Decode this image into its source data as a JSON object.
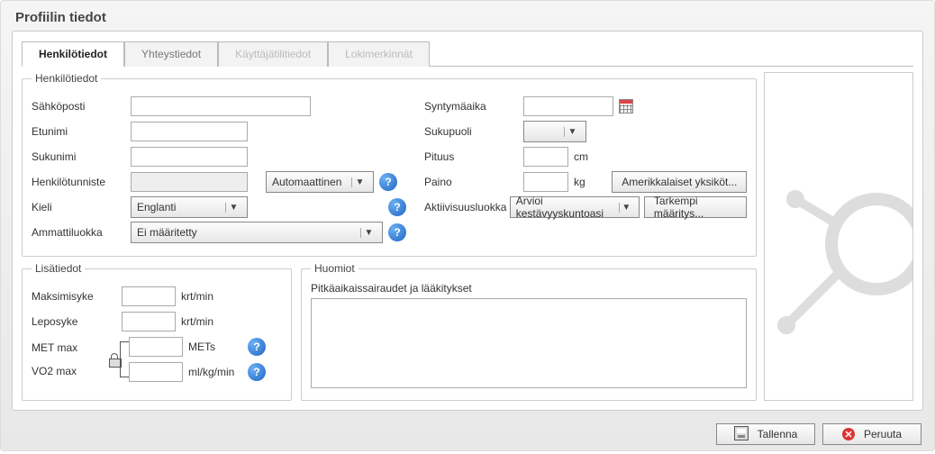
{
  "title": "Profiilin tiedot",
  "tabs": {
    "personal": "Henkilötiedot",
    "contact": "Yhteystiedot",
    "account": "Käyttäjätilitiedot",
    "log": "Lokimerkinnät"
  },
  "groups": {
    "personal": "Henkilötiedot",
    "additional": "Lisätiedot",
    "notes": "Huomiot"
  },
  "labels": {
    "email": "Sähköposti",
    "firstname": "Etunimi",
    "lastname": "Sukunimi",
    "personId": "Henkilötunniste",
    "language": "Kieli",
    "profession": "Ammattiluokka",
    "birthdate": "Syntymäaika",
    "gender": "Sukupuoli",
    "height": "Pituus",
    "weight": "Paino",
    "activity": "Aktiivisuusluokka",
    "hrmax": "Maksimisyke",
    "hrrest": "Leposyke",
    "metmax": "MET max",
    "vo2max": "VO2 max",
    "notesDesc": "Pitkäaikaissairaudet ja lääkitykset"
  },
  "units": {
    "cm": "cm",
    "kg": "kg",
    "bpm": "krt/min",
    "mets": "METs",
    "vo2": "ml/kg/min"
  },
  "buttons": {
    "auto": "Automaattinen",
    "usUnits": "Amerikkalaiset yksiköt...",
    "estimate": "Arvioi kestävyyskuntoasi",
    "refine": "Tarkempi määritys...",
    "save": "Tallenna",
    "cancel": "Peruuta"
  },
  "values": {
    "email": "",
    "firstname": "",
    "lastname": "",
    "personId": "",
    "language": "Englanti",
    "profession": "Ei määritetty",
    "birthdate": "",
    "gender": "",
    "height": "",
    "weight": "",
    "activity": "",
    "hrmax": "",
    "hrrest": "",
    "metmax": "",
    "vo2max": "",
    "notes": ""
  }
}
